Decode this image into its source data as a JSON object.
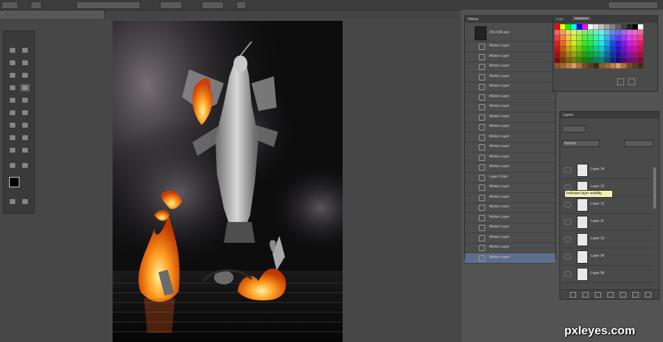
{
  "history_panel": {
    "title": "History",
    "snapshot_label": "2013 MF.psd",
    "items": [
      {
        "label": "Motion Layer"
      },
      {
        "label": "Motion Layer"
      },
      {
        "label": "Motion Layer"
      },
      {
        "label": "Motion Layer"
      },
      {
        "label": "Motion Layer"
      },
      {
        "label": "Motion Layer"
      },
      {
        "label": "Motion Layer"
      },
      {
        "label": "Motion Layer"
      },
      {
        "label": "Motion Layer"
      },
      {
        "label": "Motion Layer"
      },
      {
        "label": "Motion Layer"
      },
      {
        "label": "Motion Layer"
      },
      {
        "label": "Motion Layer"
      },
      {
        "label": "Layer Order"
      },
      {
        "label": "Motion Layer"
      },
      {
        "label": "Motion Layer"
      },
      {
        "label": "Motion Layer"
      },
      {
        "label": "Motion Layer"
      },
      {
        "label": "Motion Layer"
      },
      {
        "label": "Motion Layer"
      },
      {
        "label": "Motion Layer"
      },
      {
        "label": "Motion Layer"
      }
    ],
    "selected_index": 21
  },
  "swatches_panel": {
    "tabs": [
      "Color",
      "Swatches"
    ]
  },
  "layers_panel": {
    "title": "Layers",
    "blend_mode": "Normal",
    "layers": [
      {
        "name": "Layer 14"
      },
      {
        "name": "Layer 13"
      },
      {
        "name": "Layer 12"
      },
      {
        "name": "Layer 11"
      },
      {
        "name": "Layer 10"
      },
      {
        "name": "Layer 09"
      },
      {
        "name": "Layer 08"
      }
    ],
    "tooltip": "Indicates layer visibility"
  },
  "watermark": {
    "text": "pxleyes.com"
  },
  "colors": {
    "selection": "#5c6f8a",
    "panel_bg": "#4a4a4a",
    "fire": "#ff8a1a"
  }
}
